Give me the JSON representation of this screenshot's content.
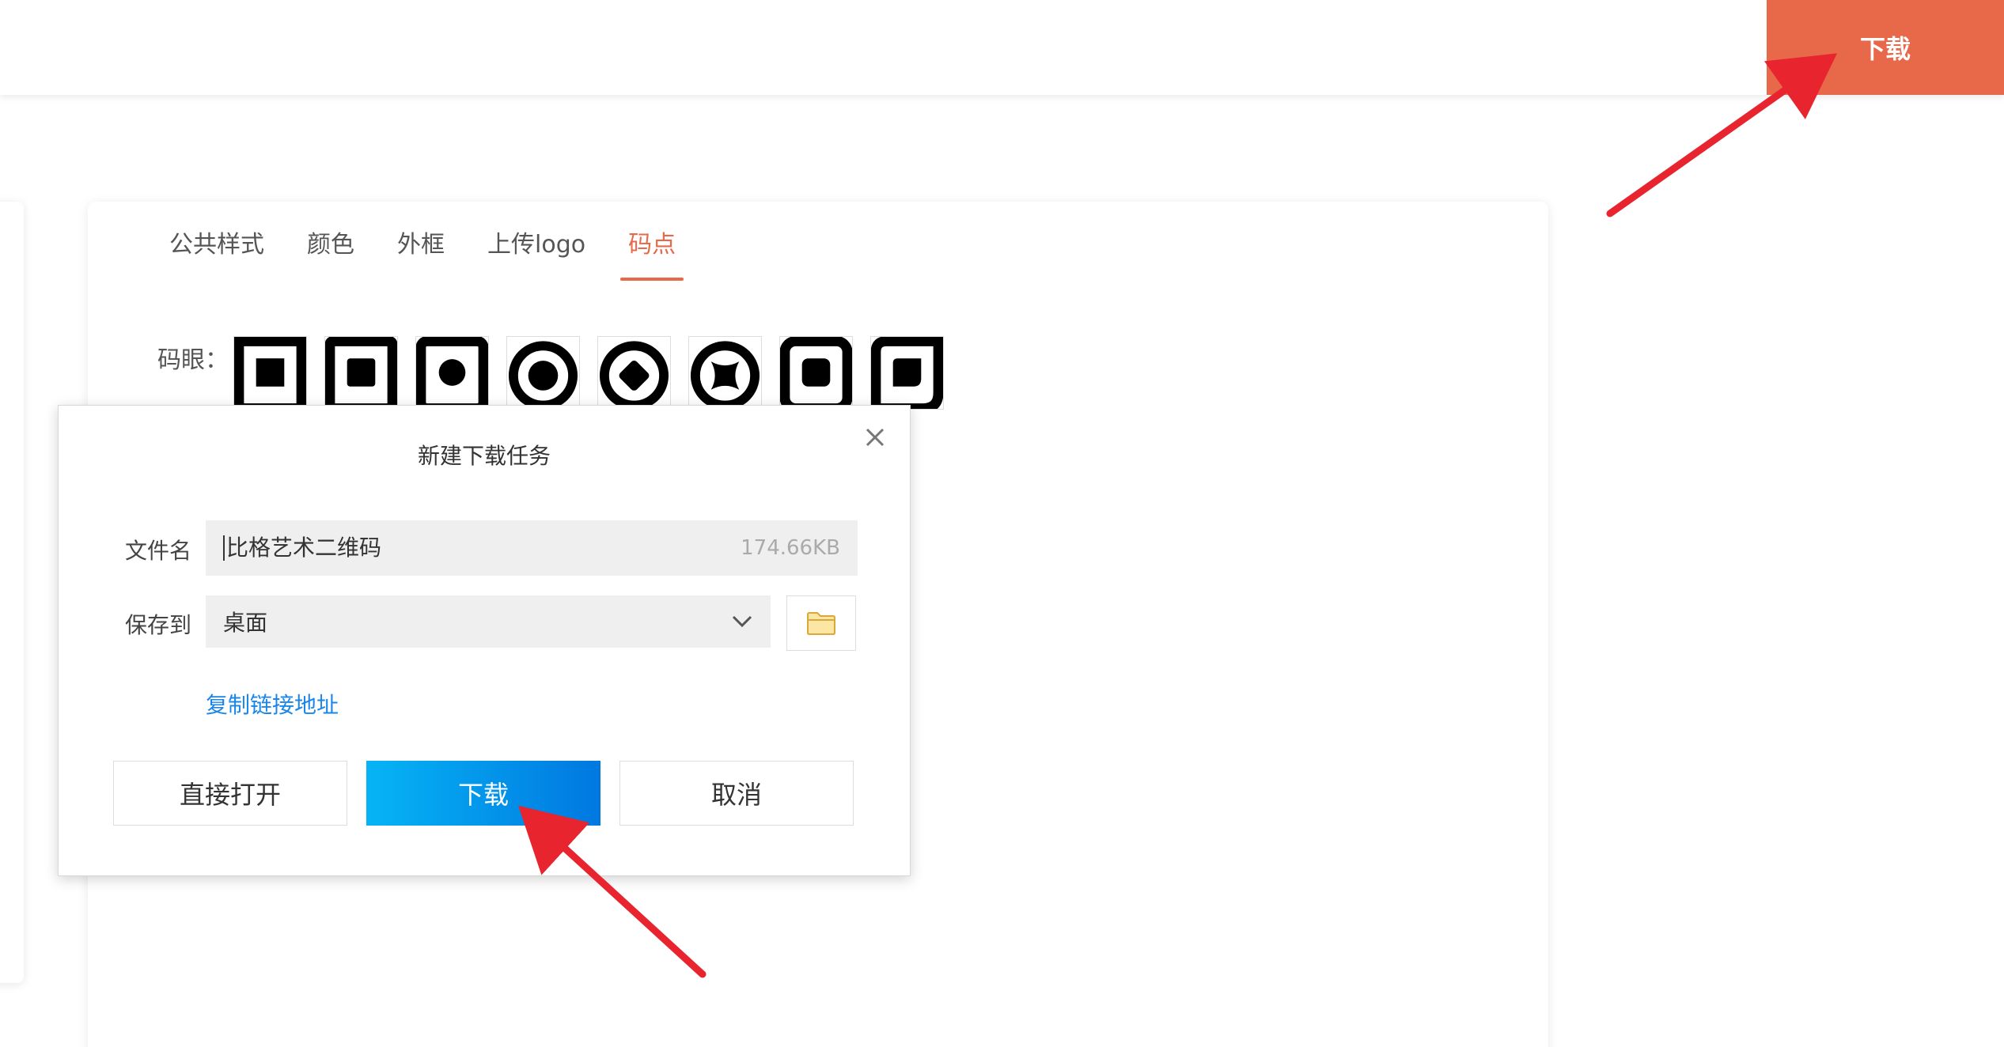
{
  "topbar": {
    "download_label": "下载"
  },
  "tabs": [
    {
      "label": "公共样式",
      "active": false
    },
    {
      "label": "颜色",
      "active": false
    },
    {
      "label": "外框",
      "active": false
    },
    {
      "label": "上传logo",
      "active": false
    },
    {
      "label": "码点",
      "active": true
    }
  ],
  "eye_section": {
    "label": "码眼："
  },
  "dialog": {
    "title": "新建下载任务",
    "filename_label": "文件名",
    "filename_value": "比格艺术二维码",
    "file_size": "174.66KB",
    "saveto_label": "保存到",
    "saveto_value": "桌面",
    "copy_link": "复制链接地址",
    "buttons": {
      "open": "直接打开",
      "download": "下载",
      "cancel": "取消"
    }
  },
  "colors": {
    "accent": "#e8694a",
    "download_gradient_start": "#06b4f5",
    "download_gradient_end": "#0078e0",
    "link": "#1a86e8",
    "annotation_arrow": "#e8242f"
  }
}
